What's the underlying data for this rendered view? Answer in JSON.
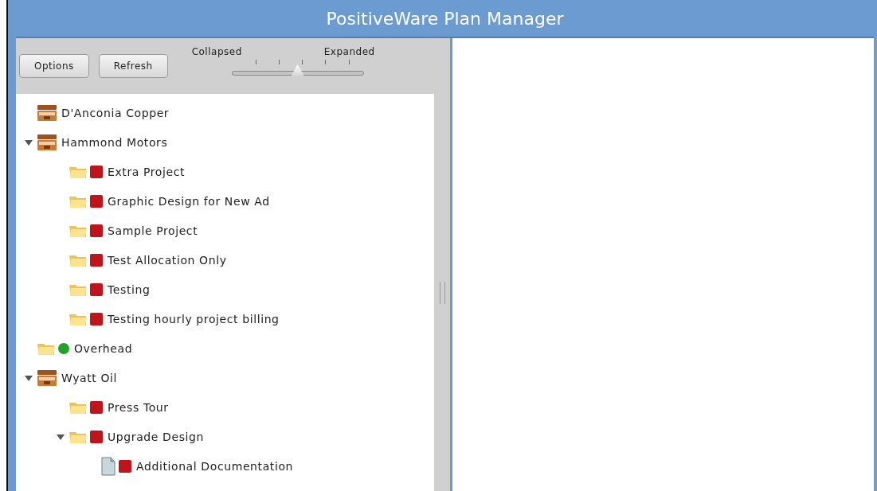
{
  "window": {
    "title": "PositiveWare Plan Manager"
  },
  "toolbar": {
    "buttons": [
      "Options",
      "Refresh"
    ],
    "slider": {
      "min_label": "Collapsed",
      "max_label": "Expanded",
      "level": 0.5
    }
  },
  "tree": [
    {
      "kind": "company",
      "label": "D'Anconia Copper"
    },
    {
      "kind": "company",
      "label": "Hammond Motors",
      "expanded": true,
      "children": [
        {
          "kind": "project",
          "label": "Extra Project",
          "color": "#c0141c"
        },
        {
          "kind": "project",
          "label": "Graphic Design for New Ad",
          "color": "#c0141c"
        },
        {
          "kind": "project",
          "label": "Sample Project",
          "color": "#c0141c"
        },
        {
          "kind": "project",
          "label": "Test Allocation Only",
          "color": "#c0141c"
        },
        {
          "kind": "project",
          "label": "Testing",
          "color": "#c0141c"
        },
        {
          "kind": "project",
          "label": "Testing hourly project billing",
          "color": "#c0141c"
        }
      ]
    },
    {
      "kind": "project",
      "label": "Overhead",
      "color": "#22a22a"
    },
    {
      "kind": "company",
      "label": "Wyatt Oil",
      "expanded": true,
      "children": [
        {
          "kind": "project",
          "label": "Press Tour",
          "color": "#c0141c"
        },
        {
          "kind": "project",
          "label": "Upgrade Design",
          "color": "#c0141c",
          "expanded": true,
          "children": [
            {
              "kind": "document",
              "label": "Additional Documentation",
              "color": "#c0141c"
            }
          ]
        }
      ]
    }
  ]
}
